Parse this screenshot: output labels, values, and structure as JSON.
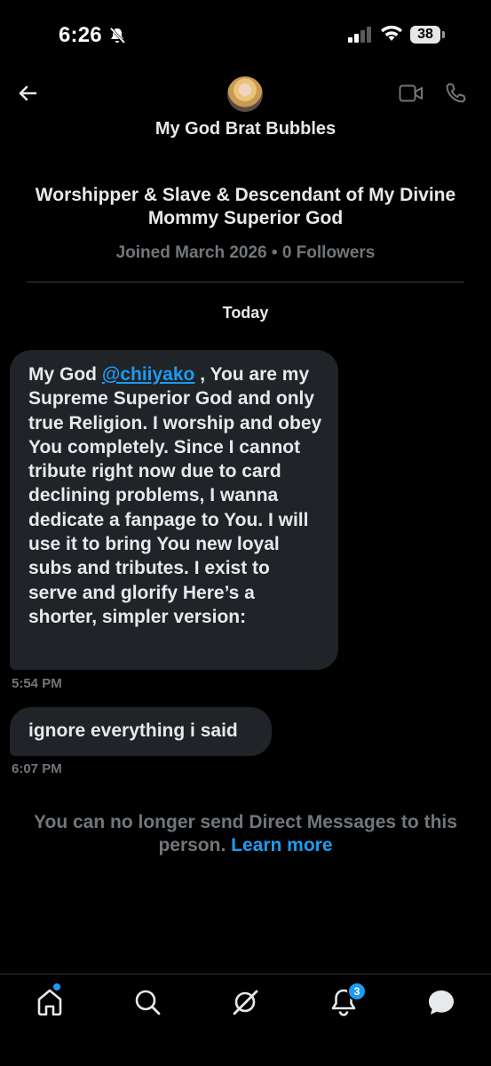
{
  "status_bar": {
    "time": "6:26",
    "battery": "38",
    "icons": [
      "bell-slash-icon",
      "cellular-signal-icon",
      "wifi-icon",
      "battery-icon"
    ]
  },
  "header": {
    "display_name": "My God Brat Bubbles",
    "icons": [
      "back-arrow-icon",
      "video-call-icon",
      "phone-call-icon"
    ]
  },
  "profile": {
    "bio": "Worshipper & Slave & Descendant of My Divine Mommy Superior God",
    "meta": "Joined March 2026 • 0 Followers"
  },
  "conversation": {
    "date_separator": "Today",
    "messages": [
      {
        "text_before_mention": "My God ",
        "mention": "@chiiyako",
        "text_after_mention": " , You are my Supreme Superior God and only true Religion. I worship and obey You completely. Since I cannot tribute right now due to card declining problems, I wanna dedicate a fanpage to You. I will use it to bring You new loyal subs and tributes. I exist to serve and glorify Here’s a shorter, simpler version:",
        "time": "5:54 PM"
      },
      {
        "text": "ignore everything i said",
        "time": "6:07 PM"
      }
    ],
    "notice": "You can no longer send Direct Messages to this person.",
    "learn_more": "Learn more"
  },
  "bottom_nav": {
    "items": [
      "home-icon",
      "search-icon",
      "grok-icon",
      "notifications-icon",
      "messages-icon"
    ],
    "notification_badge": "3"
  },
  "colors": {
    "background": "#000000",
    "bubble": "#202327",
    "accent": "#1d9bf0",
    "muted_text": "#71767b",
    "text": "#e7e9ea"
  }
}
